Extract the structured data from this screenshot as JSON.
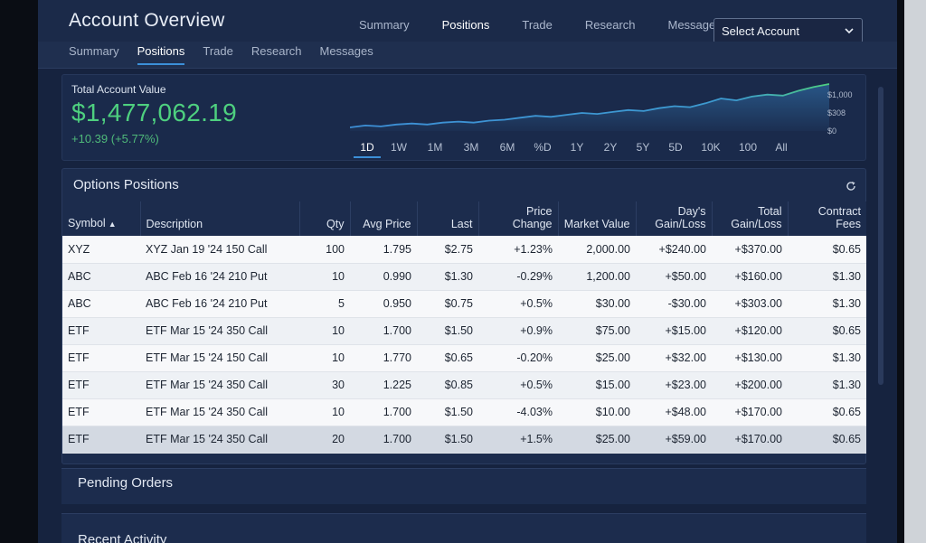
{
  "header": {
    "title": "Account Overview",
    "nav": [
      "Summary",
      "Positions",
      "Trade",
      "Research",
      "Messages"
    ],
    "nav_active": "Positions",
    "select_account": "Select Account"
  },
  "subnav": {
    "items": [
      "Summary",
      "Positions",
      "Trade",
      "Research",
      "Messages"
    ],
    "active": "Positions"
  },
  "account_value": {
    "label": "Total Account Value",
    "value": "$1,477,062.19",
    "change": "+10.39 (+5.77%)",
    "axis_labels": [
      "$1,000",
      "$308",
      "$0"
    ],
    "ranges": [
      "1D",
      "1W",
      "1M",
      "3M",
      "6M",
      "%D",
      "1Y",
      "2Y",
      "5Y",
      "5D",
      "10K",
      "100",
      "All"
    ],
    "active_range": "1D"
  },
  "chart_data": {
    "type": "area",
    "title": "",
    "xlabel": "",
    "ylabel": "",
    "values": [
      30,
      32,
      31,
      33,
      34,
      33,
      35,
      36,
      35,
      37,
      38,
      40,
      42,
      41,
      43,
      45,
      44,
      46,
      48,
      47,
      50,
      52,
      51,
      55,
      60,
      58,
      62,
      64,
      63,
      68,
      72,
      75
    ]
  },
  "options_positions": {
    "title": "Options Positions",
    "columns": [
      "Symbol",
      "Description",
      "Qty",
      "Avg Price",
      "Last",
      "Price Change",
      "Market Value",
      "Day's Gain/Loss",
      "Total Gain/Loss",
      "Contract Fees"
    ],
    "sorted_column": "Symbol",
    "rows": [
      {
        "symbol": "XYZ",
        "description": "XYZ Jan 19 '24 150 Call",
        "qty": "100",
        "avg_price": "1.795",
        "last": "$2.75",
        "price_change": "+1.23%",
        "market_value": "2,000.00",
        "days_gl": "+$240.00",
        "total_gl": "+$370.00",
        "fees": "$0.65",
        "pc_dir": "pos",
        "day_dir": "pos",
        "total_dir": "pos"
      },
      {
        "symbol": "ABC",
        "description": "ABC Feb 16 '24 210 Put",
        "qty": "10",
        "avg_price": "0.990",
        "last": "$1.30",
        "price_change": "-0.29%",
        "market_value": "1,200.00",
        "days_gl": "+$50.00",
        "total_gl": "+$160.00",
        "fees": "$1.30",
        "pc_dir": "neg",
        "day_dir": "pos",
        "total_dir": "pos"
      },
      {
        "symbol": "ABC",
        "description": "ABC Feb 16 '24 210 Put",
        "qty": "5",
        "avg_price": "0.950",
        "last": "$0.75",
        "price_change": "+0.5%",
        "market_value": "$30.00",
        "days_gl": "-$30.00",
        "total_gl": "+$303.00",
        "fees": "$1.30",
        "pc_dir": "pos",
        "day_dir": "pos",
        "total_dir": "pos"
      },
      {
        "symbol": "ETF",
        "description": "ETF Mar 15 '24 350 Call",
        "qty": "10",
        "avg_price": "1.700",
        "last": "$1.50",
        "price_change": "+0.9%",
        "market_value": "$75.00",
        "days_gl": "+$15.00",
        "total_gl": "+$120.00",
        "fees": "$0.65",
        "pc_dir": "pos",
        "day_dir": "pos",
        "total_dir": "pos"
      },
      {
        "symbol": "ETF",
        "description": "ETF Mar 15 '24 150 Call",
        "qty": "10",
        "avg_price": "1.770",
        "last": "$0.65",
        "price_change": "-0.20%",
        "market_value": "$25.00",
        "days_gl": "+$32.00",
        "total_gl": "+$130.00",
        "fees": "$1.30",
        "pc_dir": "neg",
        "day_dir": "pos",
        "total_dir": "pos"
      },
      {
        "symbol": "ETF",
        "description": "ETF Mar 15 '24 350 Call",
        "qty": "30",
        "avg_price": "1.225",
        "last": "$0.85",
        "price_change": "+0.5%",
        "market_value": "$15.00",
        "days_gl": "+$23.00",
        "total_gl": "+$200.00",
        "fees": "$1.30",
        "pc_dir": "pos",
        "day_dir": "pos",
        "total_dir": "pos"
      },
      {
        "symbol": "ETF",
        "description": "ETF Mar 15 '24 350 Call",
        "qty": "10",
        "avg_price": "1.700",
        "last": "$1.50",
        "price_change": "-4.03%",
        "market_value": "$10.00",
        "days_gl": "+$48.00",
        "total_gl": "+$170.00",
        "fees": "$0.65",
        "pc_dir": "neg",
        "day_dir": "pos",
        "total_dir": "pos"
      },
      {
        "symbol": "ETF",
        "description": "ETF Mar 15 '24 350 Call",
        "qty": "20",
        "avg_price": "1.700",
        "last": "$1.50",
        "price_change": "+1.5%",
        "market_value": "$25.00",
        "days_gl": "+$59.00",
        "total_gl": "+$170.00",
        "fees": "$0.65",
        "pc_dir": "pos",
        "day_dir": "pos",
        "total_dir": "pos",
        "selected": true
      }
    ]
  },
  "pending_orders": {
    "title": "Pending Orders"
  },
  "recent_activity": {
    "title": "Recent Activity"
  },
  "colors": {
    "positive": "#1e9c42",
    "negative": "#c8362c",
    "value_green": "#4ed07f",
    "accent": "#3c8fd8"
  }
}
